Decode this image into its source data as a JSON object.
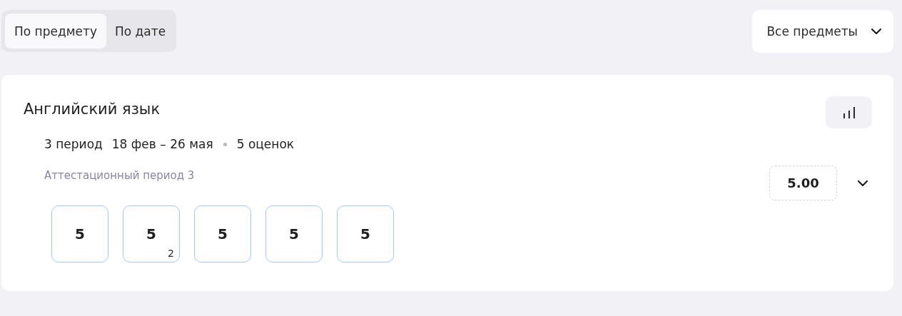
{
  "tabs": [
    {
      "label": "По предмету",
      "selected": true
    },
    {
      "label": "По дате",
      "selected": false
    }
  ],
  "subject_filter": {
    "value": "Все предметы"
  },
  "subject": {
    "title": "Английский язык",
    "period": "3 период",
    "dates": "18 фев – 26 мая",
    "count": "5 оценок",
    "period_name": "Аттестационный период 3",
    "grades": [
      {
        "value": "5"
      },
      {
        "value": "5",
        "weight": "2"
      },
      {
        "value": "5"
      },
      {
        "value": "5"
      },
      {
        "value": "5"
      }
    ],
    "average": "5.00",
    "expanded": false
  }
}
